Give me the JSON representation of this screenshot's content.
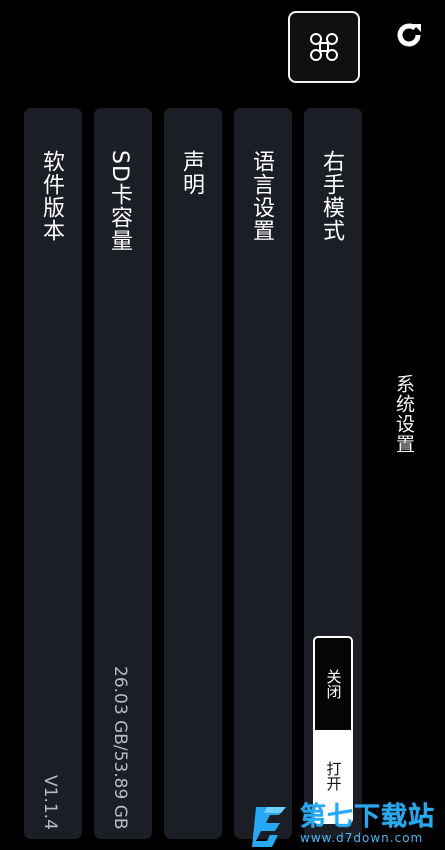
{
  "header": {
    "title": "系统设置",
    "drone_button_icon": "drone-icon",
    "refresh_icon": "refresh-icon"
  },
  "settings": {
    "right_hand_mode": {
      "label": "右手模式",
      "toggle": {
        "off_label": "关闭",
        "on_label": "打开",
        "selected": "打开"
      }
    },
    "language": {
      "label": "语言设置"
    },
    "statement": {
      "label": "声明"
    },
    "sd_card": {
      "label": "SD卡容量",
      "value": "26.03 GB/53.89 GB"
    },
    "software_version": {
      "label": "软件版本",
      "value": "V1.1.4"
    }
  },
  "watermark": {
    "brand": "第七下载站",
    "url": "www.d7down.com"
  },
  "colors": {
    "background": "#000000",
    "card": "#1b1e24",
    "text": "#ffffff",
    "muted_text": "#b9bcc2",
    "watermark": "#27a8f2"
  }
}
